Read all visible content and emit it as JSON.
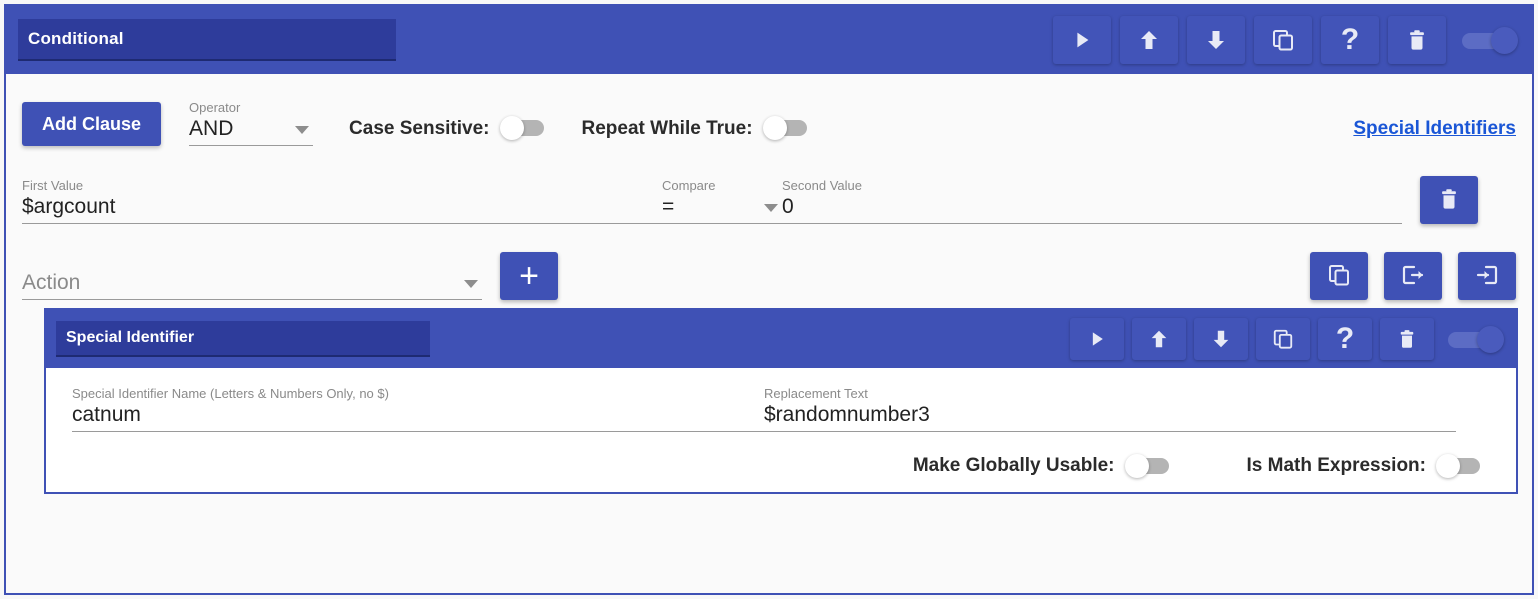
{
  "card": {
    "title": "Conditional",
    "toolbar": {
      "run_label": "run-icon",
      "move_up_label": "arrow-up-icon",
      "move_down_label": "arrow-down-icon",
      "copy_label": "copy-icon",
      "help_label": "?",
      "delete_label": "trash-icon",
      "enabled_toggle": "on"
    },
    "controls": {
      "add_clause_label": "Add Clause",
      "operator_label": "Operator",
      "operator_value": "AND",
      "case_sensitive_label": "Case Sensitive:",
      "case_sensitive_state": "off",
      "repeat_while_true_label": "Repeat While True:",
      "repeat_while_true_state": "off",
      "special_identifiers_link": "Special Identifiers"
    },
    "clause": {
      "first_value_label": "First Value",
      "first_value": "$argcount",
      "compare_label": "Compare",
      "compare_value": "=",
      "second_value_label": "Second Value",
      "second_value": "0",
      "delete_label": "trash-icon"
    },
    "action_row": {
      "action_placeholder": "Action",
      "add_label": "+",
      "copy_label": "copy-icon",
      "export_label": "export-icon",
      "import_label": "import-icon"
    }
  },
  "nested": {
    "title": "Special Identifier",
    "toolbar": {
      "run_label": "run-icon",
      "move_up_label": "arrow-up-icon",
      "move_down_label": "arrow-down-icon",
      "copy_label": "copy-icon",
      "help_label": "?",
      "delete_label": "trash-icon",
      "enabled_toggle": "on"
    },
    "fields": {
      "name_label": "Special Identifier Name (Letters & Numbers Only, no $)",
      "name_value": "catnum",
      "replacement_label": "Replacement Text",
      "replacement_value": "$randomnumber3"
    },
    "toggles": {
      "globally_usable_label": "Make Globally Usable:",
      "globally_usable_state": "off",
      "math_expression_label": "Is Math Expression:",
      "math_expression_state": "off"
    }
  },
  "colors": {
    "primary": "#3f51b5",
    "primary_dark": "#2e3c9b",
    "link": "#1a56d6",
    "page_bg": "#fafafa"
  }
}
